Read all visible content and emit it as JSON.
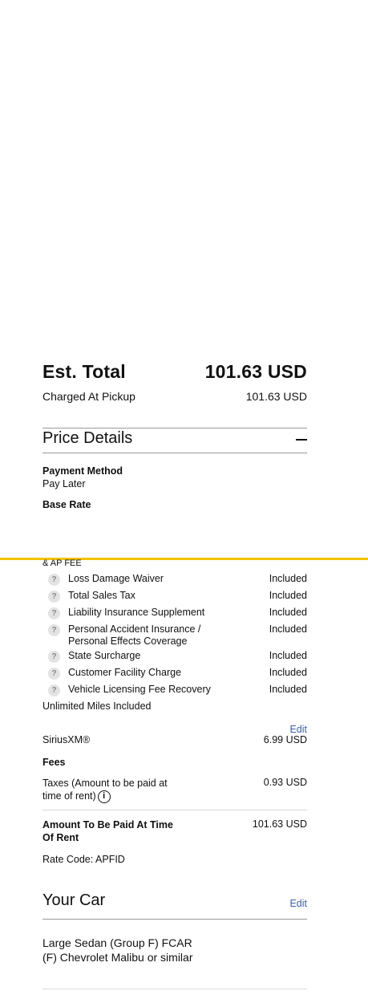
{
  "estimate": {
    "title": "Est. Total",
    "amount": "101.63 USD",
    "charged_label": "Charged At Pickup",
    "charged_amount": "101.63 USD"
  },
  "price_details": {
    "title": "Price Details",
    "payment_method_label": "Payment Method",
    "payment_method_value": "Pay Later",
    "base_rate_label": "Base Rate",
    "cut_text": "& AP FEE",
    "included_items": [
      {
        "name": "Loss Damage Waiver",
        "value": "Included"
      },
      {
        "name": "Total Sales Tax",
        "value": "Included"
      },
      {
        "name": "Liability Insurance Supplement",
        "value": "Included"
      },
      {
        "name": "Personal Accident Insurance / Personal Effects Coverage",
        "value": "Included"
      },
      {
        "name": "State Surcharge",
        "value": "Included"
      },
      {
        "name": "Customer Facility Charge",
        "value": "Included"
      },
      {
        "name": "Vehicle Licensing Fee Recovery",
        "value": "Included"
      }
    ],
    "unlimited_miles": "Unlimited Miles Included",
    "edit_label": "Edit",
    "addon_name": "SiriusXM®",
    "addon_price": "6.99 USD",
    "fees_label": "Fees",
    "taxes_label": "Taxes (Amount to be paid at time of rent)",
    "taxes_value": "0.93 USD",
    "info_glyph": "i",
    "amount_due_label": "Amount To Be Paid At Time Of Rent",
    "amount_due_value": "101.63 USD",
    "rate_code": "Rate Code: APFID"
  },
  "your_car": {
    "title": "Your Car",
    "edit_label": "Edit",
    "car_class": "Large Sedan (Group F) FCAR",
    "car_model": "(F) Chevrolet Malibu or similar"
  },
  "colors": {
    "accent_yellow": "#f2c200",
    "link_blue": "#3a5fb0"
  }
}
